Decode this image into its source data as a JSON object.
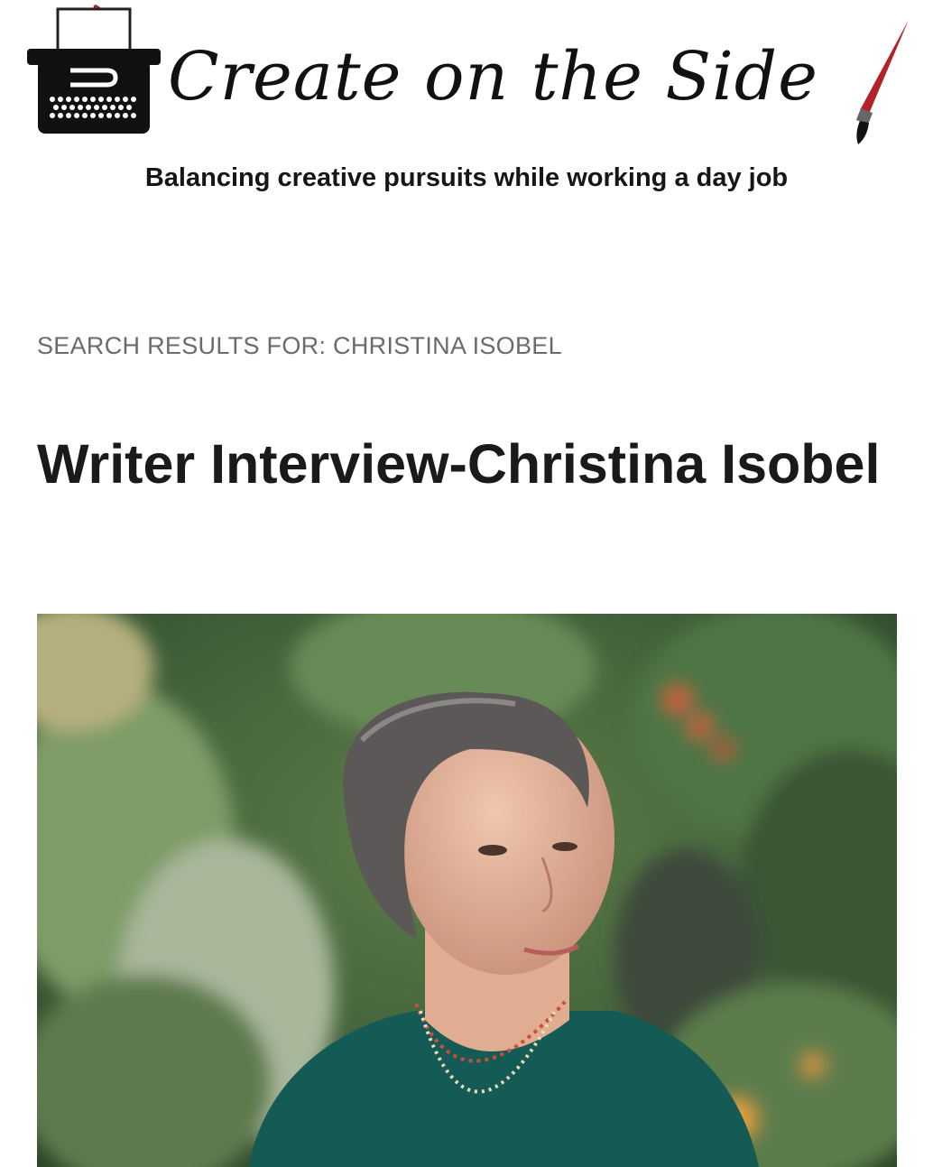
{
  "site": {
    "title": "Create on the Side",
    "tagline": "Balancing creative pursuits while working a day job",
    "logo_icon": "typewriter-icon",
    "brush_icon": "paintbrush-icon"
  },
  "search": {
    "label": "SEARCH RESULTS FOR: CHRISTINA ISOBEL"
  },
  "post": {
    "title": "Writer Interview-Christina Isobel",
    "image": "author-photo"
  },
  "colors": {
    "accent_red": "#b3222a",
    "text_dark": "#1a1a1a",
    "label_gray": "#6b6b6b"
  }
}
